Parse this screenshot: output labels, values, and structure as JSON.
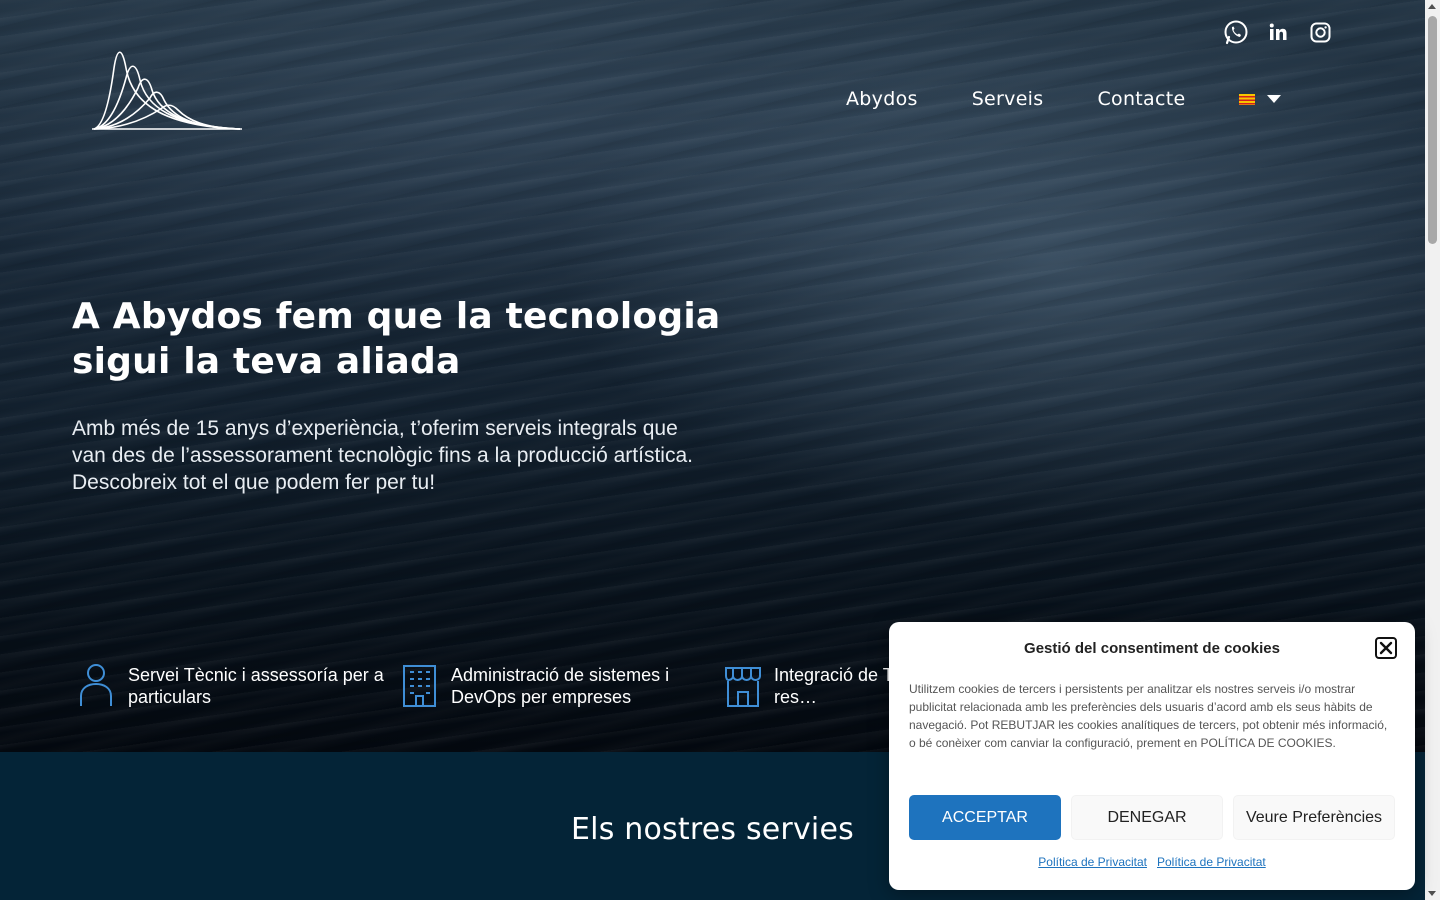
{
  "social": {
    "items": [
      {
        "icon": "whatsapp-icon"
      },
      {
        "icon": "linkedin-icon"
      },
      {
        "icon": "instagram-icon"
      }
    ]
  },
  "nav": {
    "items": [
      {
        "label": "Abydos"
      },
      {
        "label": "Serveis"
      },
      {
        "label": "Contacte"
      }
    ],
    "language_flag": "catalan-flag-icon"
  },
  "hero": {
    "title": "A Abydos fem que la tecnologia sigui la teva aliada",
    "subtitle": "Amb més de 15 anys d’experiència, t’oferim serveis integrals que van des de l’assessorament tecnològic fins a la producció artística. Descobreix tot el que podem fer per tu!"
  },
  "features": [
    {
      "icon": "person-icon",
      "text": "Servei Tècnic i assessoría per a particulars"
    },
    {
      "icon": "building-icon",
      "text": "Administració de sistemes i DevOps per empreses"
    },
    {
      "icon": "storefront-icon",
      "text": "Integració de T… hostelería i res…"
    }
  ],
  "services": {
    "heading": "Els nostres servies"
  },
  "cookie": {
    "title": "Gestió del consentiment de cookies",
    "body": "Utilitzem cookies de tercers i persistents per analitzar els nostres serveis i/o mostrar publicitat relacionada amb les preferències dels usuaris d’acord amb els seus hàbits de navegació. Pot REBUTJAR les cookies analítiques de tercers, pot obtenir més informació, o bé conèixer com canviar la configuració, prement en POLÍTICA DE COOKIES.",
    "accept_label": "ACCEPTAR",
    "deny_label": "DENEGAR",
    "prefs_label": "Veure Preferències",
    "link1": "Política de Privacitat",
    "link2": "Política de Privacitat"
  },
  "colors": {
    "accent": "#1e73be",
    "services_bg": "#042437",
    "icon_blue": "#3f8ed6"
  }
}
